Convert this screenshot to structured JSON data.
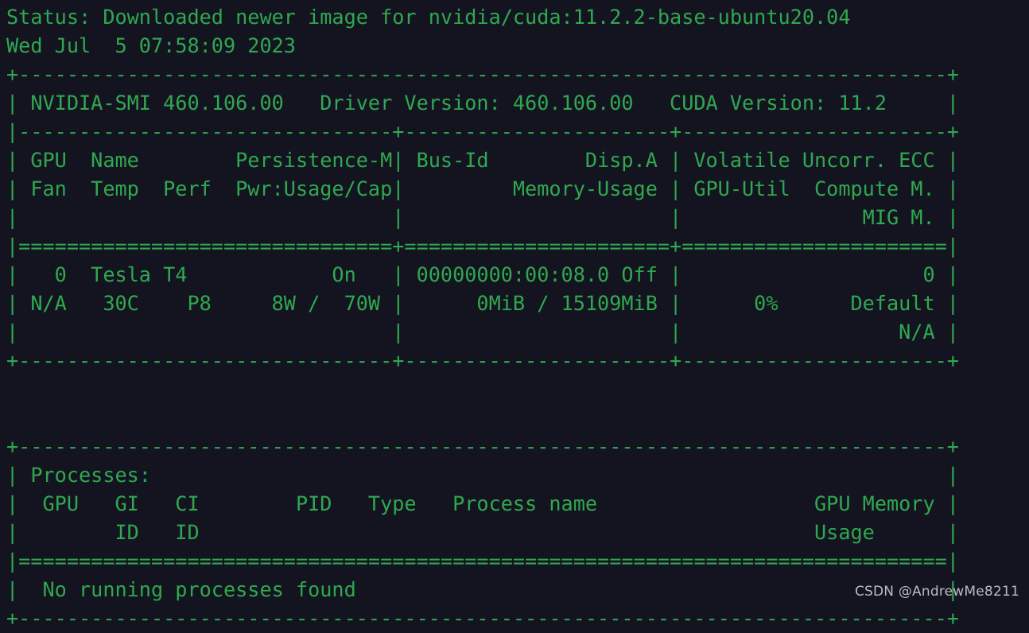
{
  "terminal": {
    "background_color": "#141421",
    "text_color": "#2fa84f",
    "watermark_color": "#b9bac4",
    "watermark": "CSDN @AndrewMe8211",
    "status_line": "Status: Downloaded newer image for nvidia/cuda:11.2.2-base-ubuntu20.04",
    "timestamp_line": "Wed Jul  5 07:58:09 2023",
    "lines": [
      "Status: Downloaded newer image for nvidia/cuda:11.2.2-base-ubuntu20.04",
      "Wed Jul  5 07:58:09 2023",
      "+-----------------------------------------------------------------------------+",
      "| NVIDIA-SMI 460.106.00   Driver Version: 460.106.00   CUDA Version: 11.2     |",
      "|-------------------------------+----------------------+----------------------+",
      "| GPU  Name        Persistence-M| Bus-Id        Disp.A | Volatile Uncorr. ECC |",
      "| Fan  Temp  Perf  Pwr:Usage/Cap|         Memory-Usage | GPU-Util  Compute M. |",
      "|                               |                      |               MIG M. |",
      "|===============================+======================+======================|",
      "|   0  Tesla T4            On   | 00000000:00:08.0 Off |                    0 |",
      "| N/A   30C    P8     8W /  70W |      0MiB / 15109MiB |      0%      Default |",
      "|                               |                      |                  N/A |",
      "+-------------------------------+----------------------+----------------------+",
      "",
      "",
      "+-----------------------------------------------------------------------------+",
      "| Processes:                                                                  |",
      "|  GPU   GI   CI        PID   Type   Process name                  GPU Memory |",
      "|        ID   ID                                                   Usage      |",
      "|=============================================================================|",
      "|  No running processes found                                                 |",
      "+-----------------------------------------------------------------------------+"
    ],
    "smi": {
      "smi_version_label": "NVIDIA-SMI",
      "smi_version": "460.106.00",
      "driver_version_label": "Driver Version:",
      "driver_version": "460.106.00",
      "cuda_version_label": "CUDA Version:",
      "cuda_version": "11.2",
      "gpu_table": {
        "headers_row1": [
          "GPU",
          "Name",
          "Persistence-M",
          "Bus-Id",
          "Disp.A",
          "Volatile Uncorr. ECC"
        ],
        "headers_row2": [
          "Fan",
          "Temp",
          "Perf",
          "Pwr:Usage/Cap",
          "Memory-Usage",
          "GPU-Util",
          "Compute M."
        ],
        "headers_row3": [
          "MIG M."
        ],
        "rows": [
          {
            "index": "0",
            "name": "Tesla T4",
            "persistence_m": "On",
            "bus_id": "00000000:00:08.0",
            "disp_a": "Off",
            "ecc": "0",
            "fan": "N/A",
            "temp": "30C",
            "perf": "P8",
            "pwr_usage": "8W",
            "pwr_cap": "70W",
            "memory_used": "0MiB",
            "memory_total": "15109MiB",
            "gpu_util": "0%",
            "compute_m": "Default",
            "mig_m": "N/A"
          }
        ]
      },
      "processes_table": {
        "title": "Processes:",
        "headers_row1": [
          "GPU",
          "GI",
          "CI",
          "PID",
          "Type",
          "Process name",
          "GPU Memory"
        ],
        "headers_row2": [
          "ID",
          "ID",
          "Usage"
        ],
        "empty_message": "No running processes found",
        "rows": []
      }
    }
  }
}
